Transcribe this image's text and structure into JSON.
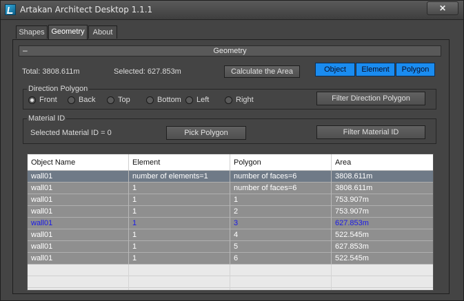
{
  "window": {
    "title": "Artakan Architect Desktop 1.1.1",
    "close_glyph": "✕"
  },
  "tabs": [
    {
      "label": "Shapes",
      "active": false
    },
    {
      "label": "Geometry",
      "active": true
    },
    {
      "label": "About",
      "active": false
    }
  ],
  "rollout": {
    "toggle_glyph": "–",
    "title": "Geometry"
  },
  "summary": {
    "total": "Total: 3808.611m",
    "selected": "Selected: 627.853m",
    "calc_button": "Calculate the Area"
  },
  "mode_buttons": [
    "Object",
    "Element",
    "Polygon"
  ],
  "direction": {
    "label": "Direction Polygon",
    "options": [
      "Front",
      "Back",
      "Top",
      "Bottom",
      "Left",
      "Right"
    ],
    "selected": "Front",
    "filter_button": "Filter Direction Polygon"
  },
  "material": {
    "label": "Material ID",
    "selected_text": "Selected Material ID = 0",
    "pick_button": "Pick Polygon",
    "filter_button": "Filter Material ID"
  },
  "table": {
    "columns": [
      "Object Name",
      "Element",
      "Polygon",
      "Area"
    ],
    "rows": [
      [
        "wall01",
        "number of elements=1",
        "number of faces=6",
        "3808.611m"
      ],
      [
        "wall01",
        "1",
        "number of faces=6",
        "3808.611m"
      ],
      [
        "wall01",
        "1",
        "1",
        "753.907m"
      ],
      [
        "wall01",
        "1",
        "2",
        "753.907m"
      ],
      [
        "wall01",
        "1",
        "3",
        "627.853m"
      ],
      [
        "wall01",
        "1",
        "4",
        "522.545m"
      ],
      [
        "wall01",
        "1",
        "5",
        "627.853m"
      ],
      [
        "wall01",
        "1",
        "6",
        "522.545m"
      ]
    ],
    "selected_row": 0,
    "highlighted_row": 4,
    "empty_rows": 3
  },
  "colors": {
    "mode_button_blue": "#1a8cf0",
    "highlight_text": "#1a1ae8",
    "selected_row_bg": "#6f7a87"
  }
}
